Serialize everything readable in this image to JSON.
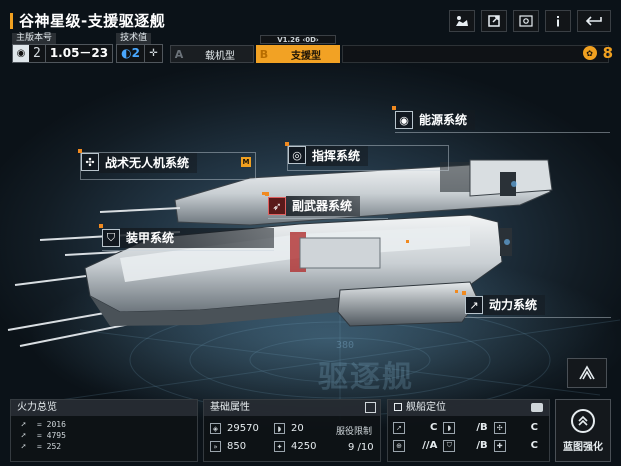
{
  "title": "谷神星级-支援驱逐舰",
  "top_icons": [
    "share-icon",
    "export-icon",
    "view-icon",
    "info-icon",
    "back-icon"
  ],
  "version": {
    "main_label": "主版本号",
    "main_tier": "2",
    "main_value": "1.05－23",
    "tech_label": "技术值",
    "tech_value": "2"
  },
  "type_tabs": [
    {
      "letter": "A",
      "label": "载机型",
      "selected": false
    },
    {
      "letter": "B",
      "label": "支援型",
      "selected": true,
      "tag": "V1.26 ‹0D›"
    }
  ],
  "currency": "8",
  "watermark": {
    "text": "驱逐舰",
    "number": "380"
  },
  "systems": [
    {
      "name": "能源系统",
      "icon": "power-icon"
    },
    {
      "name": "指挥系统",
      "icon": "command-icon"
    },
    {
      "name": "战术无人机系统",
      "icon": "drone-icon",
      "tag": "M"
    },
    {
      "name": "副武器系统",
      "icon": "missile-icon"
    },
    {
      "name": "装甲系统",
      "icon": "shield-icon"
    },
    {
      "name": "动力系统",
      "icon": "engine-icon"
    }
  ],
  "firepower": {
    "title": "火力总览",
    "rows": [
      "2016",
      "4795",
      "252"
    ]
  },
  "attributes": {
    "title": "基础属性",
    "hp": "29570",
    "armor": "20",
    "speed": "850",
    "energy": "4250",
    "service_label": "服役限制",
    "service_value": "9 /10"
  },
  "positioning": {
    "title": "舰船定位",
    "cells": [
      "C",
      "/B",
      "C",
      "//A",
      "/B",
      "C"
    ]
  },
  "blueprint_label": "蓝图强化"
}
